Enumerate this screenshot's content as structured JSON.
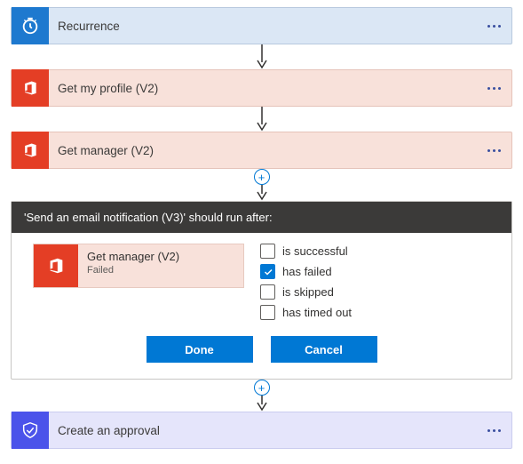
{
  "steps": {
    "recurrence": {
      "title": "Recurrence"
    },
    "profile": {
      "title": "Get my profile (V2)"
    },
    "manager": {
      "title": "Get manager (V2)"
    },
    "approval": {
      "title": "Create an approval"
    }
  },
  "runafter": {
    "header": "'Send an email notification (V3)' should run after:",
    "predecessor": {
      "title": "Get manager (V2)",
      "status": "Failed"
    },
    "options": {
      "successful": {
        "label": "is successful",
        "checked": false
      },
      "failed": {
        "label": "has failed",
        "checked": true
      },
      "skipped": {
        "label": "is skipped",
        "checked": false
      },
      "timedout": {
        "label": "has timed out",
        "checked": false
      }
    },
    "buttons": {
      "done": "Done",
      "cancel": "Cancel"
    }
  }
}
